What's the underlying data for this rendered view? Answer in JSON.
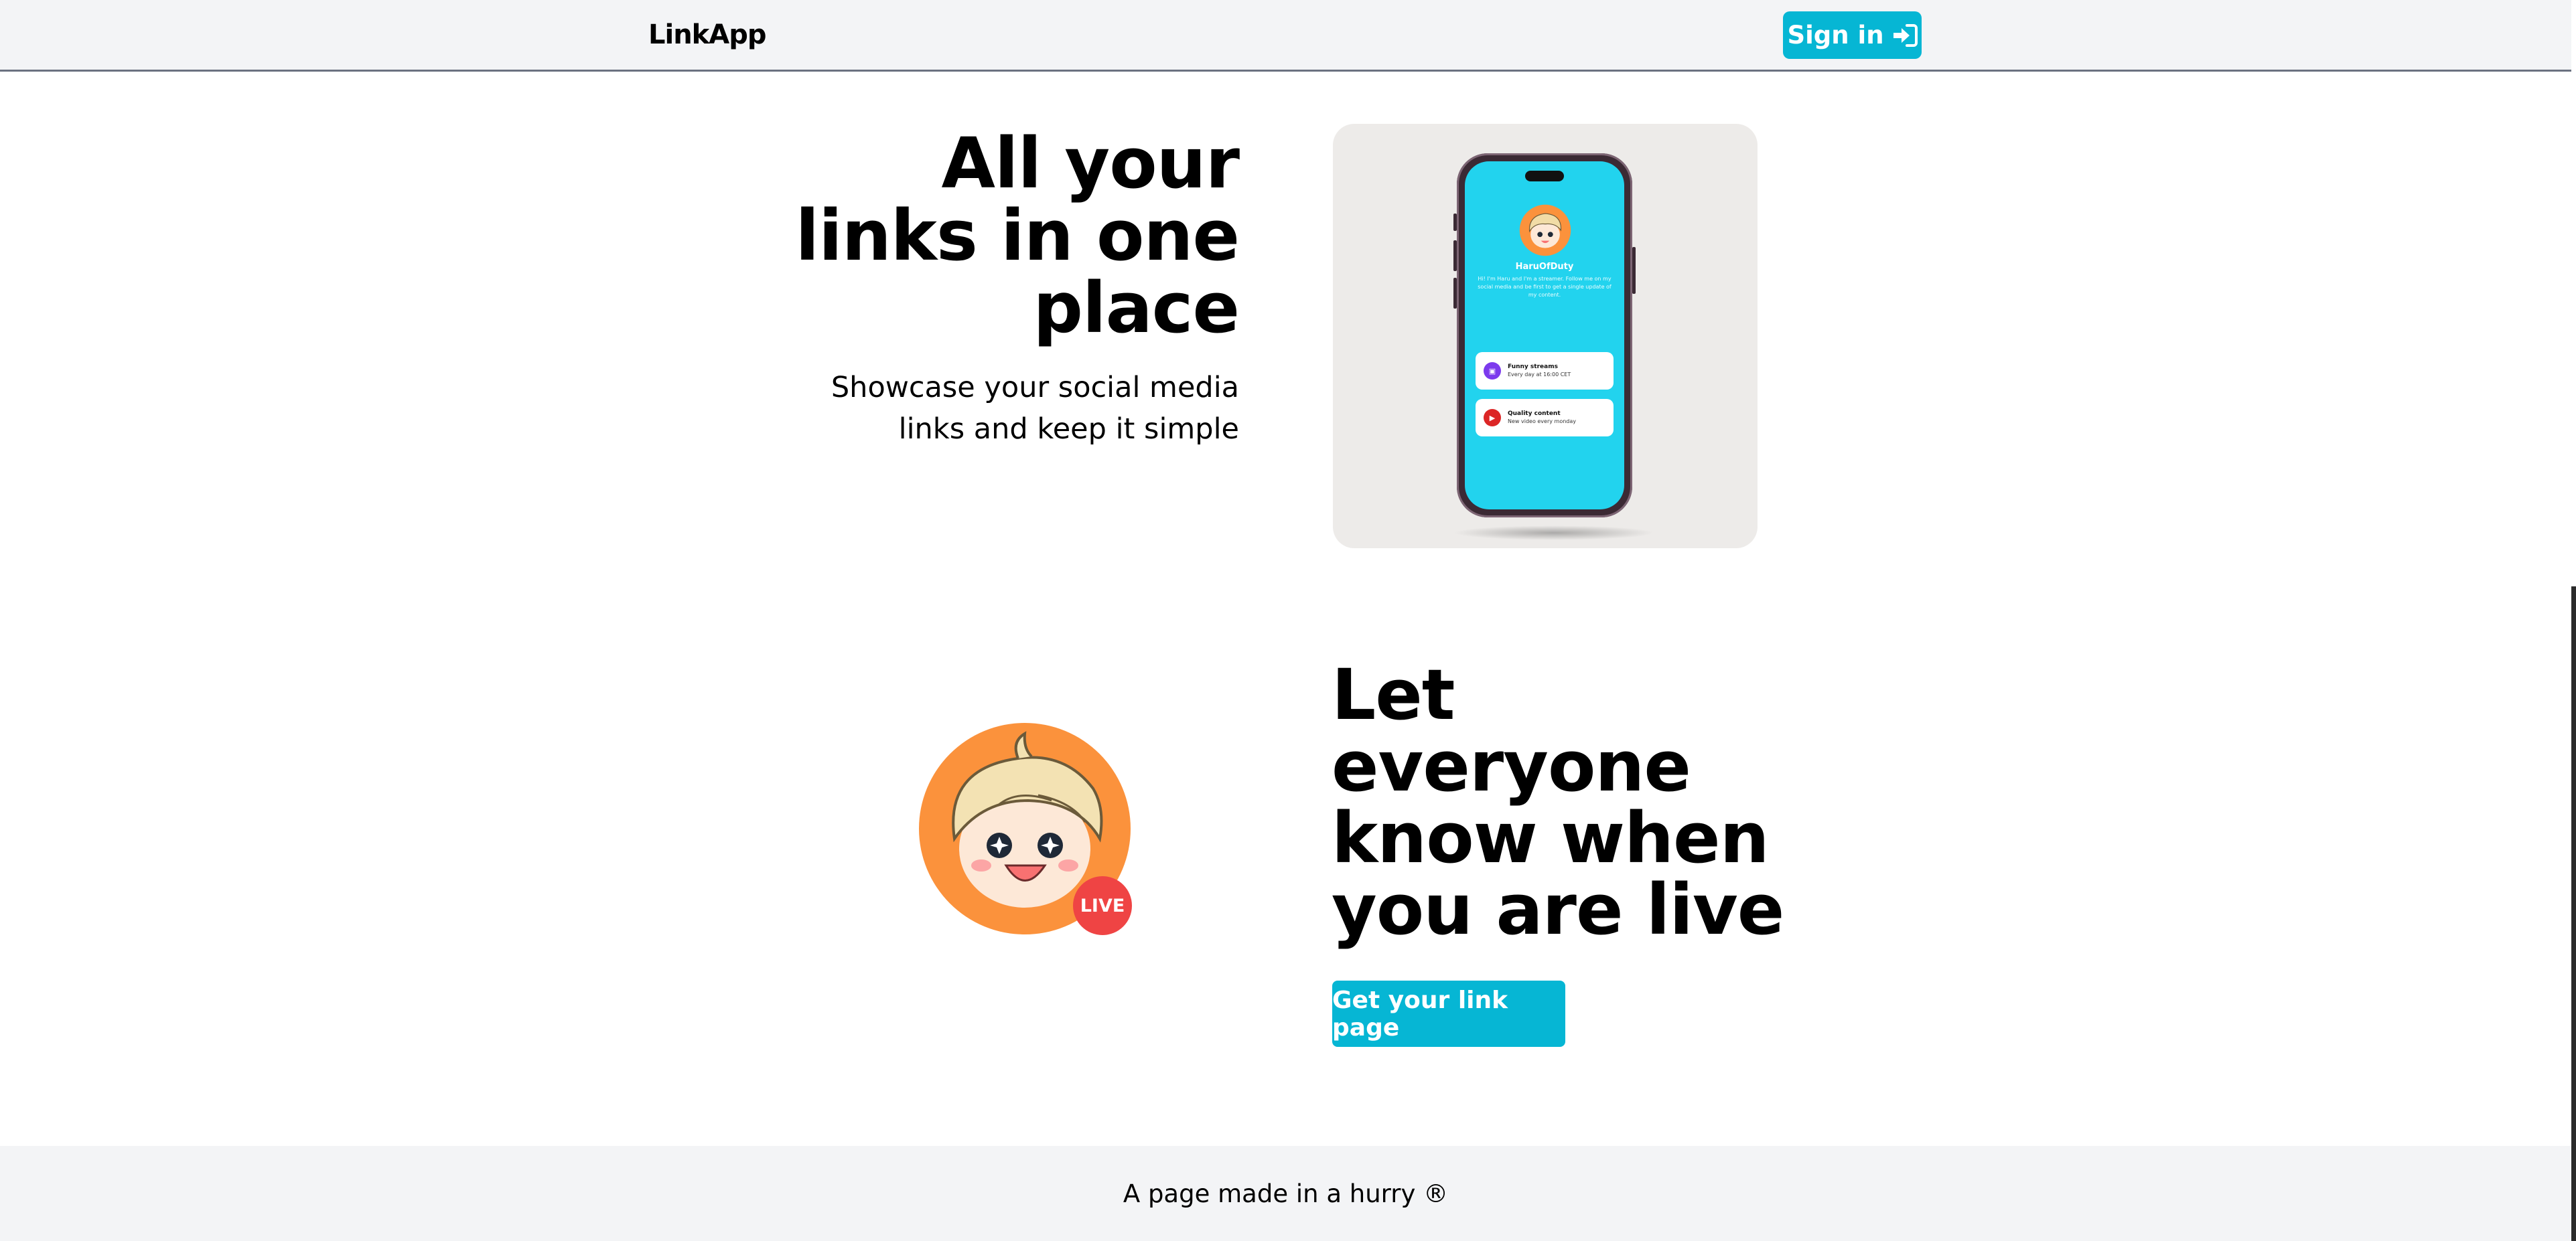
{
  "header": {
    "brand": "LinkApp",
    "signin_label": "Sign in"
  },
  "hero": {
    "title_lines": [
      "All your",
      "links in one",
      "place"
    ],
    "subtitle_lines": [
      "Showcase your social media",
      "links and keep it simple"
    ],
    "phone": {
      "name": "HaruOfDuty",
      "bio": "Hi! I'm Haru and I'm a streamer. Follow me on my social media and be first to get a single update of my content.",
      "links": [
        {
          "title": "Funny streams",
          "desc": "Every day at 16:00 CET",
          "icon": "twitch-icon",
          "color": "#7c3aed"
        },
        {
          "title": "Quality content",
          "desc": "New video every monday",
          "icon": "youtube-icon",
          "color": "#dc2626"
        }
      ]
    }
  },
  "live": {
    "title_lines": [
      "Let",
      "everyone",
      "know when",
      "you are live"
    ],
    "badge": "LIVE",
    "cta_label": "Get your link page"
  },
  "footer": {
    "text": "A page made in a hurry ®"
  },
  "colors": {
    "accent": "#06b6d4",
    "phone_screen": "#22d3ee",
    "live_badge": "#ef4444",
    "avatar_bg": "#fb923c",
    "header_bg": "#f3f4f6"
  }
}
